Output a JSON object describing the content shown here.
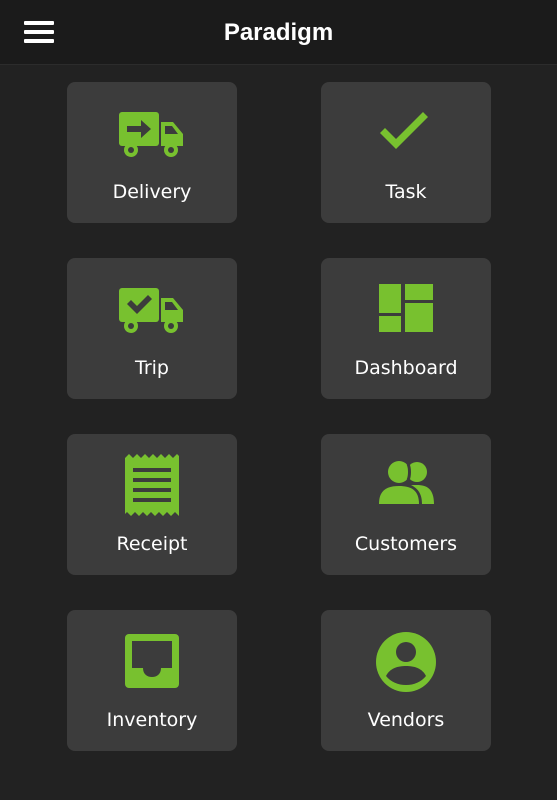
{
  "app": {
    "title": "Paradigm",
    "accent_color": "#78c12f"
  },
  "header": {
    "menu_icon": "hamburger-menu-icon"
  },
  "tiles": [
    {
      "label": "Delivery",
      "icon": "truck-arrow-icon"
    },
    {
      "label": "Task",
      "icon": "checkmark-icon"
    },
    {
      "label": "Trip",
      "icon": "truck-check-icon"
    },
    {
      "label": "Dashboard",
      "icon": "dashboard-icon"
    },
    {
      "label": "Receipt",
      "icon": "receipt-icon"
    },
    {
      "label": "Customers",
      "icon": "people-icon"
    },
    {
      "label": "Inventory",
      "icon": "inbox-tray-icon"
    },
    {
      "label": "Vendors",
      "icon": "account-circle-icon"
    }
  ]
}
